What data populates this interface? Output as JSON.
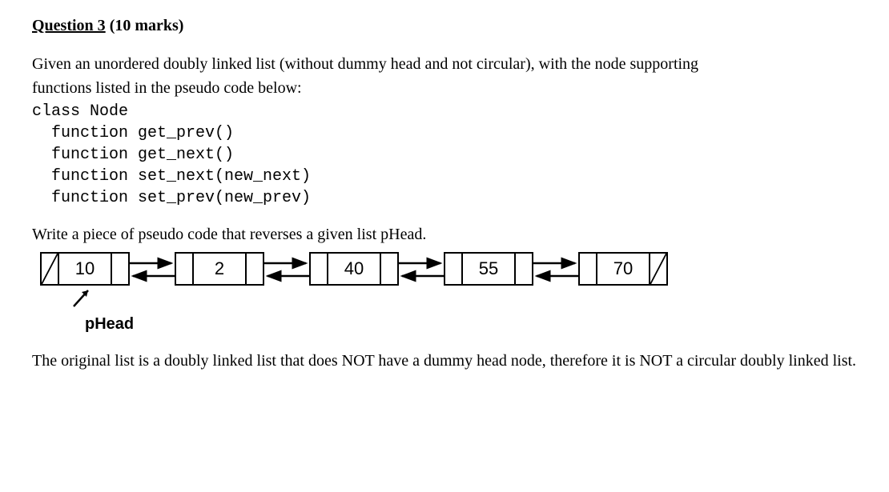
{
  "heading": {
    "title": "Question 3",
    "marks": "(10 marks)"
  },
  "intro": {
    "line1": "Given an unordered doubly linked list (without dummy head and not circular), with the node supporting",
    "line2": "functions listed in the pseudo code below:"
  },
  "code": "class Node\n  function get_prev()\n  function get_next()\n  function set_next(new_next)\n  function set_prev(new_prev)",
  "task": "Write a piece of pseudo code that reverses a given list pHead.",
  "nodes": {
    "n1": "10",
    "n2": "2",
    "n3": "40",
    "n4": "55",
    "n5": "70"
  },
  "pointer": "pHead",
  "footer": "The original list is a doubly linked list that does NOT have a dummy head node, therefore it is NOT a circular doubly linked list."
}
